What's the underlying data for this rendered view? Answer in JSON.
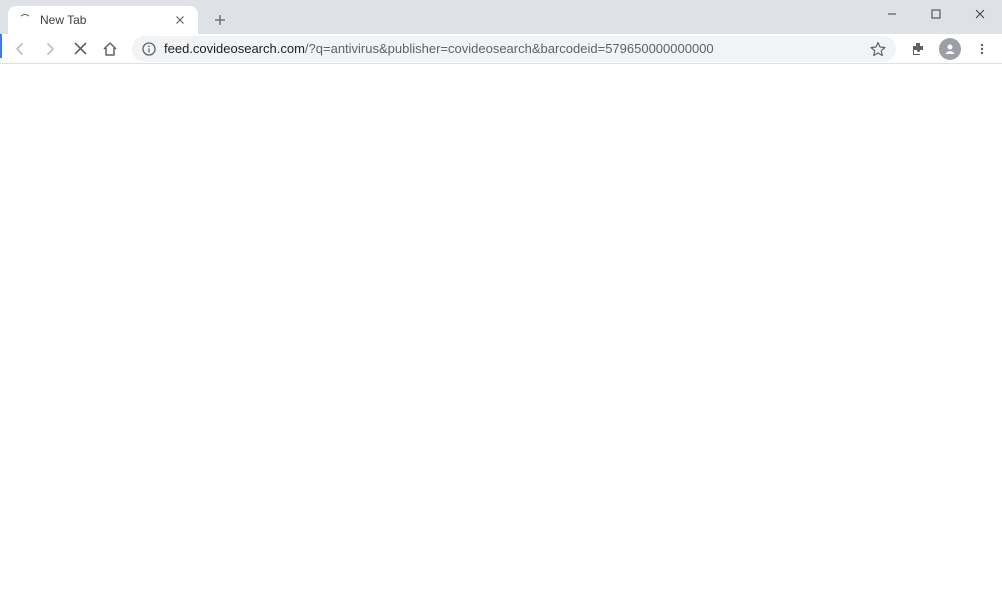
{
  "window": {
    "tab_title": "New Tab"
  },
  "toolbar": {
    "url_domain": "feed.covideosearch.com",
    "url_path": "/?q=antivirus&publisher=covideosearch&barcodeid=579650000000000"
  },
  "icons": {
    "back": "back",
    "forward": "forward",
    "stop": "stop",
    "home": "home",
    "info": "info",
    "star": "star",
    "extensions": "extensions",
    "profile": "profile",
    "menu": "menu",
    "close_tab": "close",
    "new_tab": "plus",
    "minimize": "minimize",
    "maximize": "maximize",
    "close_window": "close"
  }
}
